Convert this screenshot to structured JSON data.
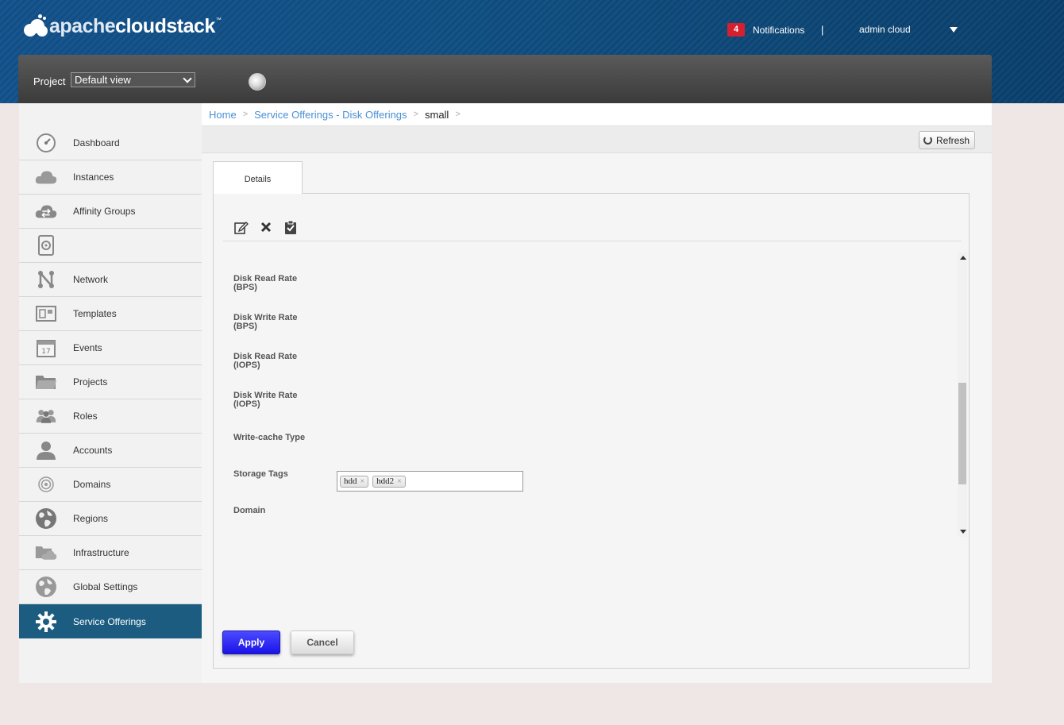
{
  "header": {
    "logo_part1": "apache",
    "logo_part2": "cloudstack",
    "logo_tm": "™",
    "notifications_count": "4",
    "notifications_label": "Notifications",
    "separator": "|",
    "user": "admin cloud"
  },
  "project": {
    "label": "Project",
    "selected": "Default view"
  },
  "sidebar": {
    "items": [
      {
        "label": "Dashboard",
        "icon": "dashboard-icon"
      },
      {
        "label": "Instances",
        "icon": "cloud-icon"
      },
      {
        "label": "Affinity Groups",
        "icon": "affinity-icon"
      },
      {
        "label": "",
        "icon": "storage-icon"
      },
      {
        "label": "Network",
        "icon": "network-icon"
      },
      {
        "label": "Templates",
        "icon": "templates-icon"
      },
      {
        "label": "Events",
        "icon": "calendar-icon"
      },
      {
        "label": "Projects",
        "icon": "folder-icon"
      },
      {
        "label": "Roles",
        "icon": "roles-icon"
      },
      {
        "label": "Accounts",
        "icon": "user-icon"
      },
      {
        "label": "Domains",
        "icon": "domains-icon"
      },
      {
        "label": "Regions",
        "icon": "globe-icon"
      },
      {
        "label": "Infrastructure",
        "icon": "infrastructure-icon"
      },
      {
        "label": "Global Settings",
        "icon": "globe-settings-icon"
      },
      {
        "label": "Service Offerings",
        "icon": "gear-icon"
      }
    ],
    "active": "Service Offerings"
  },
  "breadcrumb": {
    "home": "Home",
    "section": "Service Offerings - Disk Offerings",
    "current": "small",
    "sep": ">"
  },
  "toolbar": {
    "refresh": "Refresh"
  },
  "tabs": {
    "details": "Details"
  },
  "details": {
    "fields": [
      {
        "label": "Disk Read Rate (BPS)"
      },
      {
        "label": "Disk Write Rate (BPS)"
      },
      {
        "label": "Disk Read Rate (IOPS)"
      },
      {
        "label": "Disk Write Rate (IOPS)"
      },
      {
        "label": "Write-cache Type"
      },
      {
        "label": "Storage Tags"
      },
      {
        "label": "Domain"
      }
    ],
    "storage_tags": [
      "hdd",
      "hdd2"
    ]
  },
  "buttons": {
    "apply": "Apply",
    "cancel": "Cancel"
  }
}
